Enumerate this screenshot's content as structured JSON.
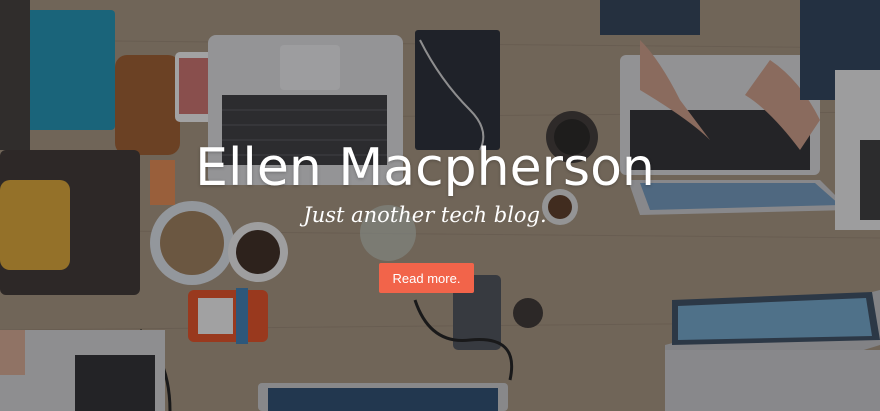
{
  "hero": {
    "site_title": "Ellen Macpherson",
    "tagline": "Just another tech blog.",
    "cta_label": "Read more.",
    "cta_color": "#f2644a",
    "text_color": "#ffffff"
  },
  "background": {
    "description_icon": "desk-workspace-photo",
    "table_color": "#a8957f"
  }
}
